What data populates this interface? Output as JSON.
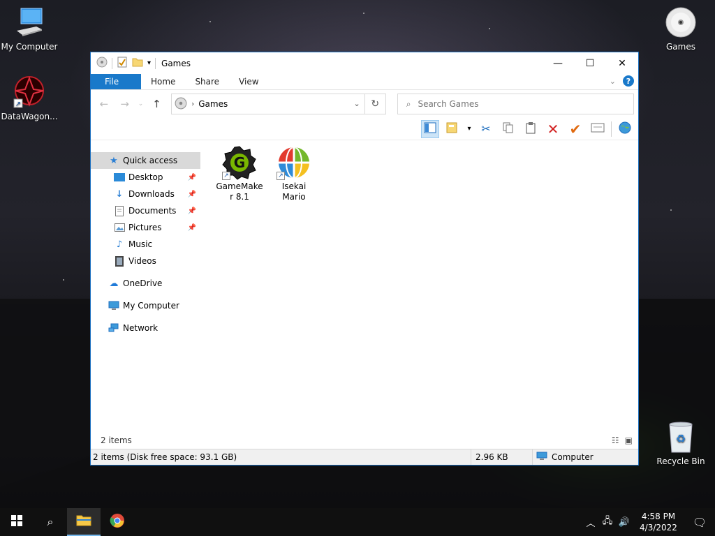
{
  "desktop": {
    "icons": [
      {
        "label": "My Computer"
      },
      {
        "label": "DataWagon..."
      },
      {
        "label": "Games"
      },
      {
        "label": "Recycle Bin"
      }
    ]
  },
  "window": {
    "title": "Games",
    "tabs": [
      {
        "label": "File"
      },
      {
        "label": "Home"
      },
      {
        "label": "Share"
      },
      {
        "label": "View"
      }
    ],
    "help_label": "?",
    "address": {
      "crumb": "Games"
    },
    "search": {
      "placeholder": "Search Games"
    },
    "nav": [
      {
        "label": "Quick access",
        "icon": "star-icon"
      },
      {
        "label": "Desktop",
        "icon": "desktop-icon",
        "pinned": true
      },
      {
        "label": "Downloads",
        "icon": "download-icon",
        "pinned": true
      },
      {
        "label": "Documents",
        "icon": "document-icon",
        "pinned": true
      },
      {
        "label": "Pictures",
        "icon": "picture-icon",
        "pinned": true
      },
      {
        "label": "Music",
        "icon": "music-icon"
      },
      {
        "label": "Videos",
        "icon": "video-icon"
      },
      {
        "label": "OneDrive",
        "icon": "cloud-icon"
      },
      {
        "label": "My Computer",
        "icon": "computer-icon"
      },
      {
        "label": "Network",
        "icon": "network-icon"
      }
    ],
    "files": [
      {
        "label_line1": "GameMake",
        "label_line2": "r 8.1",
        "icon": "gamemaker-icon"
      },
      {
        "label_line1": "Isekai",
        "label_line2": "Mario",
        "icon": "globe-icon"
      }
    ],
    "item_count": "2 items",
    "status": {
      "summary": "2 items (Disk free space: 93.1 GB)",
      "size": "2.96 KB",
      "location": "Computer"
    }
  },
  "taskbar": {
    "time": "4:58 PM",
    "date": "4/3/2022"
  },
  "colors": {
    "accent": "#1979ca",
    "window_border": "#1c6fbf",
    "taskbar": "#101010"
  }
}
